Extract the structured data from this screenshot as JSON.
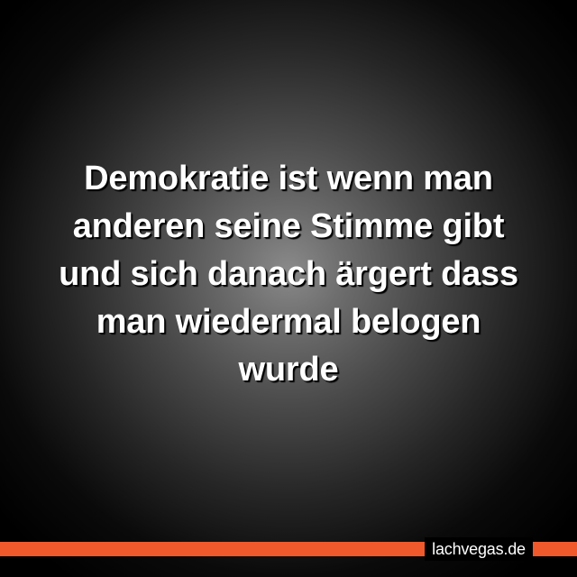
{
  "quote": {
    "lines": [
      "Demokratie ist wenn man",
      "anderen seine Stimme gibt",
      "und sich danach ärgert dass",
      "man wiedermal belogen",
      "wurde"
    ]
  },
  "footer": {
    "site_label": "lachvegas.de"
  },
  "colors": {
    "accent": "#f0592b",
    "text": "#ffffff",
    "background_center": "#8a8a8a",
    "background_edge": "#000000"
  }
}
